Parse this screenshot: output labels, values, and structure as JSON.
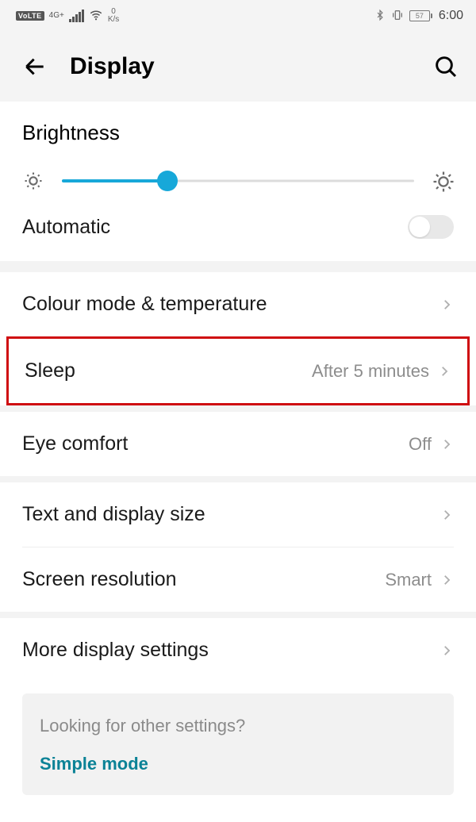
{
  "status": {
    "volte": "VoLTE",
    "net_label": "4G+",
    "speed_value": "0",
    "speed_unit": "K/s",
    "battery": "57",
    "time": "6:00"
  },
  "header": {
    "title": "Display"
  },
  "brightness": {
    "label": "Brightness",
    "percent": 30,
    "auto_label": "Automatic",
    "auto_on": false
  },
  "rows": {
    "colour": {
      "label": "Colour mode & temperature",
      "value": ""
    },
    "sleep": {
      "label": "Sleep",
      "value": "After 5 minutes"
    },
    "eye": {
      "label": "Eye comfort",
      "value": "Off"
    },
    "text": {
      "label": "Text and display size",
      "value": ""
    },
    "resolution": {
      "label": "Screen resolution",
      "value": "Smart"
    },
    "more": {
      "label": "More display settings",
      "value": ""
    }
  },
  "infobox": {
    "question": "Looking for other settings?",
    "link": "Simple mode"
  },
  "colors": {
    "accent": "#17a8d9",
    "highlight": "#cf0d11",
    "link": "#0b8296"
  }
}
